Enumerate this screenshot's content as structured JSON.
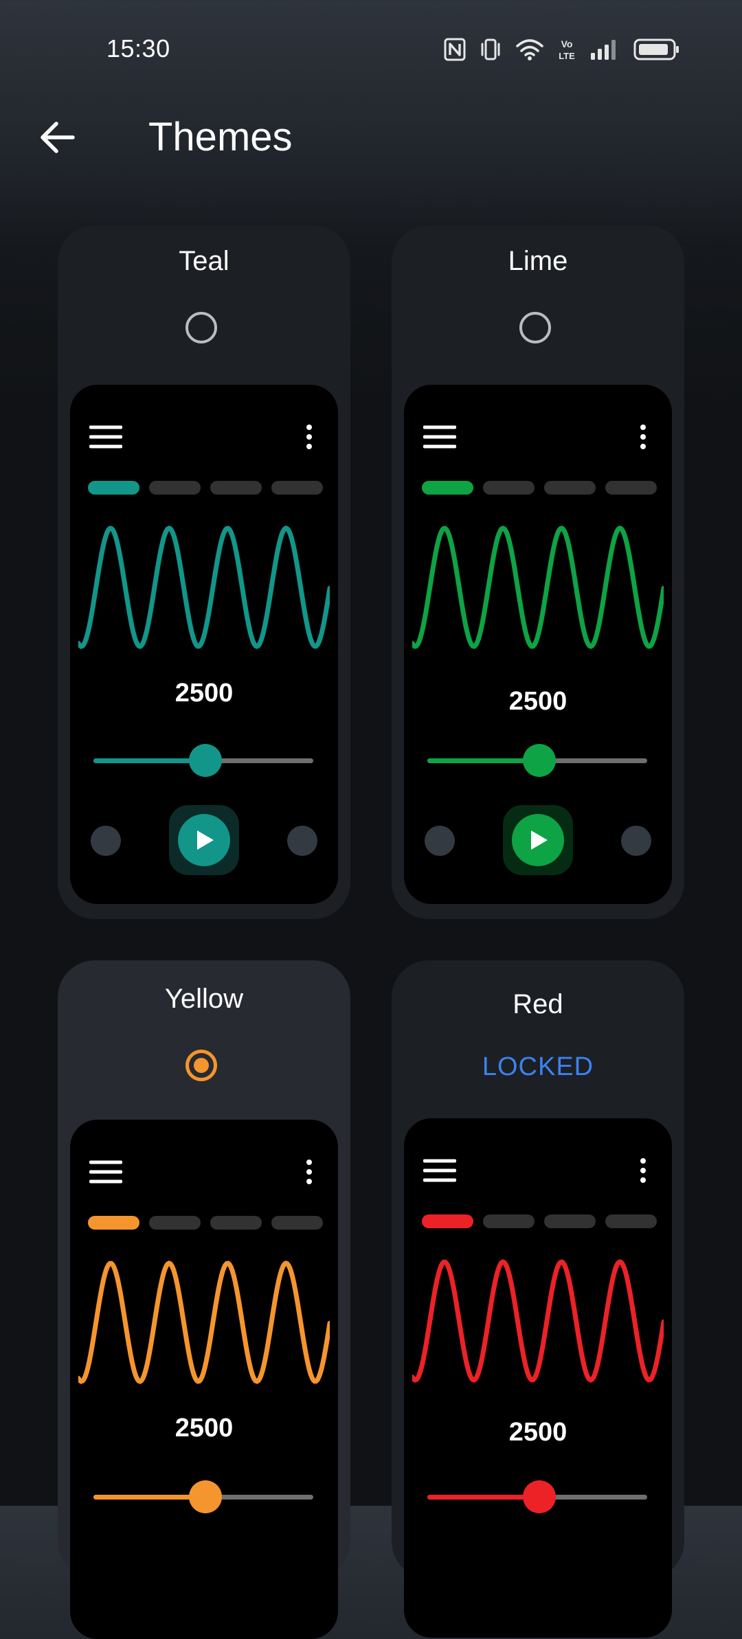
{
  "status_bar": {
    "time": "15:30",
    "icons": [
      "nfc-icon",
      "vibrate-icon",
      "wifi-icon",
      "volte-icon",
      "signal-icon",
      "battery-icon"
    ],
    "volte_top": "Vo",
    "volte_bottom": "LTE"
  },
  "app_bar": {
    "back_icon": "arrow-back-icon",
    "title": "Themes"
  },
  "themes": [
    {
      "name": "Teal",
      "accent": "#12968a",
      "accent_dark": "#0b2a28",
      "selected": false,
      "locked": false,
      "status_label": "",
      "preview_value": "2500",
      "slider_level": 0.51
    },
    {
      "name": "Lime",
      "accent": "#0ea345",
      "accent_dark": "#062b13",
      "selected": false,
      "locked": false,
      "status_label": "",
      "preview_value": "2500",
      "slider_level": 0.51
    },
    {
      "name": "Yellow",
      "accent": "#f5952d",
      "accent_dark": "#3a2410",
      "selected": true,
      "locked": false,
      "status_label": "",
      "preview_value": "2500",
      "slider_level": 0.51
    },
    {
      "name": "Red",
      "accent": "#ec2227",
      "accent_dark": "#3a0c0d",
      "selected": false,
      "locked": true,
      "status_label": "LOCKED",
      "preview_value": "2500",
      "slider_level": 0.51
    }
  ],
  "colors": {
    "background_top": "#2e343c",
    "background_bottom": "#101215",
    "card": "#1c1f24",
    "card_selected": "#272a30",
    "radio_unchecked": "#b9bcc0",
    "locked_text": "#3b82f0"
  }
}
